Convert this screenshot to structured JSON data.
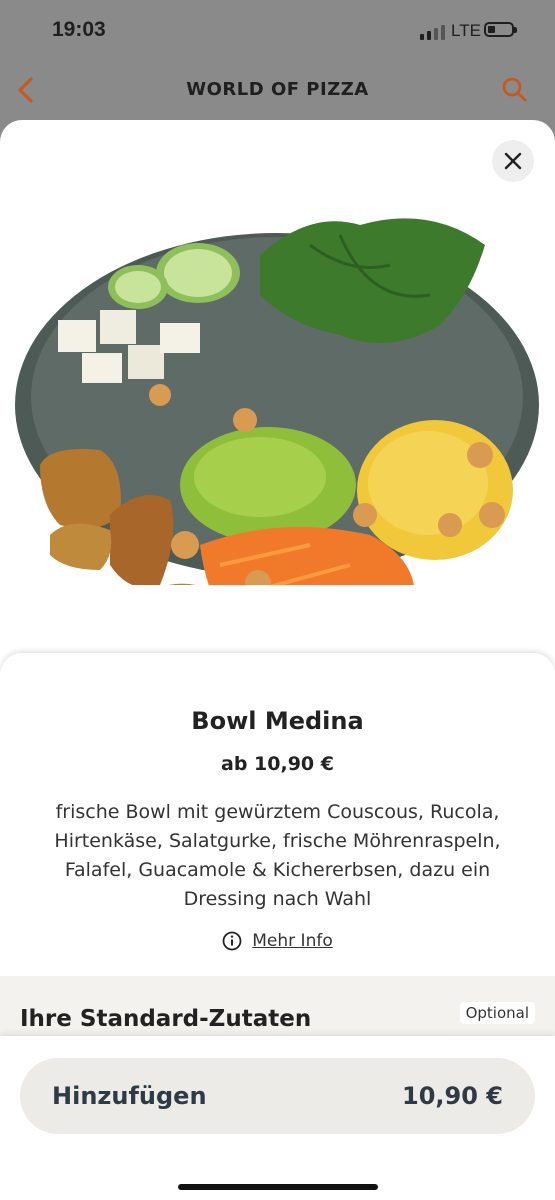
{
  "status": {
    "time": "19:03",
    "network": "LTE"
  },
  "header": {
    "title": "WORLD OF PIZZA",
    "accent": "#c65a1e"
  },
  "product": {
    "name": "Bowl Medina",
    "price": "ab 10,90 €",
    "description": "frische Bowl mit gewürztem Couscous, Rucola, Hirtenkäse, Salatgurke, frische Möhrenraspeln, Falafel, Guacamole & Kichererbsen, dazu ein Dressing nach Wahl",
    "more_info": "Mehr Info"
  },
  "section": {
    "title": "Ihre Standard-Zutaten",
    "badge": "Optional"
  },
  "footer": {
    "add_label": "Hinzufügen",
    "add_price": "10,90 €"
  }
}
